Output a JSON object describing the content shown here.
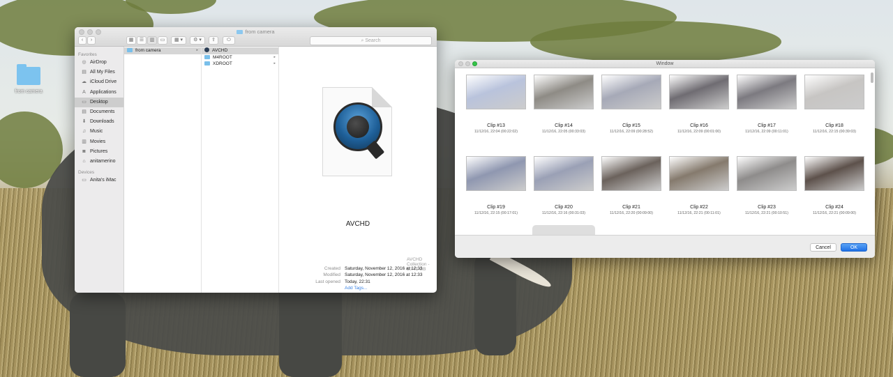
{
  "desktop": {
    "icon_label": "from camera"
  },
  "finder": {
    "title": "from camera",
    "search_placeholder": "Search",
    "toolbar": {
      "back": "‹",
      "forward": "›",
      "view_icons": "▦",
      "view_list": "☰",
      "view_columns": "▥",
      "view_gallery": "▭",
      "arrange": "▦ ▾",
      "action": "⚙ ▾",
      "share": "⇪",
      "tags": "⬭"
    },
    "sidebar": {
      "favorites_heading": "Favorites",
      "favorites": [
        {
          "label": "AirDrop",
          "icon": "airdrop-icon",
          "glyph": "◎"
        },
        {
          "label": "All My Files",
          "icon": "all-files-icon",
          "glyph": "▤"
        },
        {
          "label": "iCloud Drive",
          "icon": "cloud-icon",
          "glyph": "☁"
        },
        {
          "label": "Applications",
          "icon": "applications-icon",
          "glyph": "A"
        },
        {
          "label": "Desktop",
          "icon": "desktop-icon",
          "glyph": "▭"
        },
        {
          "label": "Documents",
          "icon": "documents-icon",
          "glyph": "▤"
        },
        {
          "label": "Downloads",
          "icon": "downloads-icon",
          "glyph": "⬇"
        },
        {
          "label": "Music",
          "icon": "music-icon",
          "glyph": "♫"
        },
        {
          "label": "Movies",
          "icon": "movies-icon",
          "glyph": "▥"
        },
        {
          "label": "Pictures",
          "icon": "pictures-icon",
          "glyph": "◙"
        },
        {
          "label": "anitamerino",
          "icon": "home-icon",
          "glyph": "⌂"
        }
      ],
      "devices_heading": "Devices",
      "devices": [
        {
          "label": "Anita's iMac",
          "icon": "imac-icon",
          "glyph": "▭"
        }
      ]
    },
    "column1": [
      {
        "label": "from camera",
        "arrow": "▸"
      }
    ],
    "column2": [
      {
        "label": "AVCHD",
        "arrow": ""
      },
      {
        "label": "M4ROOT",
        "arrow": "▸"
      },
      {
        "label": "XDROOT",
        "arrow": "▸"
      }
    ],
    "preview": {
      "name": "AVCHD",
      "kind": "AVCHD Collection - 50.41 GB",
      "meta": [
        {
          "key": "Created",
          "value": "Saturday, November 12, 2016 at 12:33"
        },
        {
          "key": "Modified",
          "value": "Saturday, November 12, 2016 at 12:33"
        },
        {
          "key": "Last opened",
          "value": "Today, 22:31"
        }
      ],
      "add_tags": "Add Tags..."
    }
  },
  "picker": {
    "title": "Window",
    "clips": [
      {
        "title": "Clip #13",
        "meta": "11/12/16, 22:04 (00:22:02)",
        "color": "#b9c3dc"
      },
      {
        "title": "Clip #14",
        "meta": "11/12/16, 22:05 (00:33:03)",
        "color": "#8e8b85"
      },
      {
        "title": "Clip #15",
        "meta": "11/12/16, 22:09 (00:28:52)",
        "color": "#a6a9b7"
      },
      {
        "title": "Clip #16",
        "meta": "11/12/16, 22:09 (00:01:00)",
        "color": "#6f6c72"
      },
      {
        "title": "Clip #17",
        "meta": "11/12/16, 22:09 (00:11:01)",
        "color": "#7c7a80"
      },
      {
        "title": "Clip #18",
        "meta": "11/12/16, 22:15 (00:39:03)",
        "color": "#c7c5c3"
      },
      {
        "title": "Clip #19",
        "meta": "11/12/16, 22:15 (00:17:01)",
        "color": "#8f97b0"
      },
      {
        "title": "Clip #20",
        "meta": "11/12/16, 22:16 (00:31:03)",
        "color": "#9aa0b5"
      },
      {
        "title": "Clip #21",
        "meta": "11/12/16, 22:20 (00:09:00)",
        "color": "#6b625c"
      },
      {
        "title": "Clip #22",
        "meta": "11/12/16, 22:21 (00:11:01)",
        "color": "#857a6d"
      },
      {
        "title": "Clip #23",
        "meta": "11/12/16, 22:21 (00:10:51)",
        "color": "#8e8c8b"
      },
      {
        "title": "Clip #24",
        "meta": "11/12/16, 22:21 (00:09:00)",
        "color": "#5d514b"
      }
    ],
    "cancel_label": "Cancel",
    "ok_label": "OK"
  }
}
